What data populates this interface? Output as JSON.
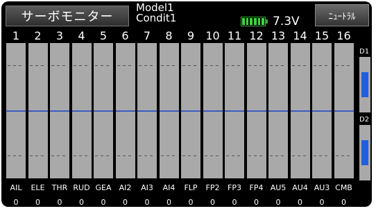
{
  "header": {
    "title_button": "サーボモニター",
    "model_name": "Model1",
    "condition_name": "Condit1",
    "battery_voltage": "7.3V",
    "neutral_button": "ﾆｭｰﾄﾗﾙ",
    "battery_icon": "battery-full-icon"
  },
  "channels": [
    {
      "num": "1",
      "fn": "AIL",
      "value": "0"
    },
    {
      "num": "2",
      "fn": "ELE",
      "value": "0"
    },
    {
      "num": "3",
      "fn": "THR",
      "value": "0"
    },
    {
      "num": "4",
      "fn": "RUD",
      "value": "0"
    },
    {
      "num": "5",
      "fn": "GEA",
      "value": "0"
    },
    {
      "num": "6",
      "fn": "AI2",
      "value": "0"
    },
    {
      "num": "7",
      "fn": "AI3",
      "value": "0"
    },
    {
      "num": "8",
      "fn": "AI4",
      "value": "0"
    },
    {
      "num": "9",
      "fn": "FLP",
      "value": "0"
    },
    {
      "num": "10",
      "fn": "FP2",
      "value": "0"
    },
    {
      "num": "11",
      "fn": "FP3",
      "value": "0"
    },
    {
      "num": "12",
      "fn": "FP4",
      "value": "0"
    },
    {
      "num": "13",
      "fn": "AU5",
      "value": "0"
    },
    {
      "num": "14",
      "fn": "AU4",
      "value": "0"
    },
    {
      "num": "15",
      "fn": "AU3",
      "value": "0"
    },
    {
      "num": "16",
      "fn": "CMB",
      "value": "0"
    }
  ],
  "digital_channels": [
    {
      "label": "D1",
      "level": 0.45
    },
    {
      "label": "D2",
      "level": 0.45
    }
  ],
  "colors": {
    "background": "#000000",
    "bar": "#a9a9a9",
    "center_line": "#3a5cc0",
    "digital_fill": "#1f5fe0",
    "battery": "#3fd23f"
  }
}
